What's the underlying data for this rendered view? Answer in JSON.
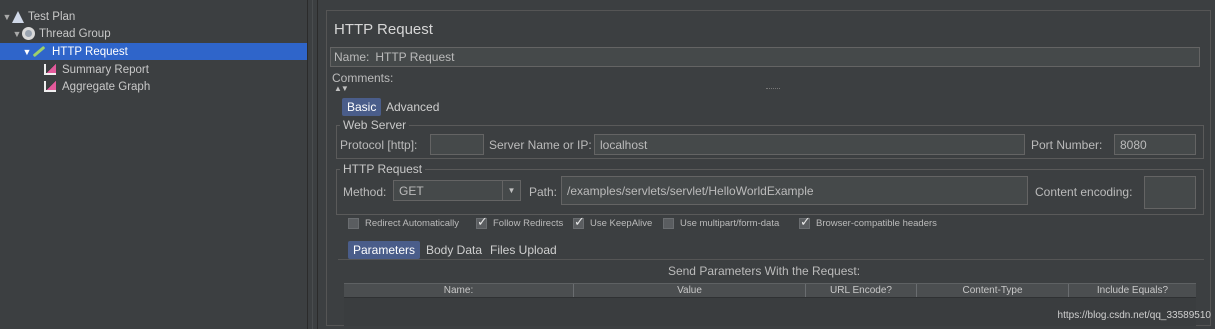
{
  "tree": {
    "items": [
      {
        "label": "Test Plan",
        "icon": "test-plan-icon"
      },
      {
        "label": "Thread Group",
        "icon": "thread-group-icon"
      },
      {
        "label": "HTTP Request",
        "icon": "http-request-icon",
        "selected": true
      },
      {
        "label": "Summary Report",
        "icon": "summary-report-icon"
      },
      {
        "label": "Aggregate Graph",
        "icon": "aggregate-graph-icon"
      }
    ]
  },
  "panel": {
    "title": "HTTP Request",
    "name_label": "Name:",
    "name_value": "HTTP Request",
    "comments_label": "Comments:",
    "collapse_glyph": "▲▼",
    "tabs": [
      {
        "label": "Basic",
        "active": true
      },
      {
        "label": "Advanced",
        "active": false
      }
    ],
    "web_server": {
      "title": "Web Server",
      "protocol_label": "Protocol [http]:",
      "protocol_value": "",
      "server_label": "Server Name or IP:",
      "server_value": "localhost",
      "port_label": "Port Number:",
      "port_value": "8080"
    },
    "http_request": {
      "title": "HTTP Request",
      "method_label": "Method:",
      "method_value": "GET",
      "path_label": "Path:",
      "path_value": "/examples/servlets/servlet/HelloWorldExample",
      "encoding_label": "Content encoding:",
      "encoding_value": ""
    },
    "checkboxes": [
      {
        "label": "Redirect Automatically",
        "checked": false
      },
      {
        "label": "Follow Redirects",
        "checked": true
      },
      {
        "label": "Use KeepAlive",
        "checked": true
      },
      {
        "label": "Use multipart/form-data",
        "checked": false
      },
      {
        "label": "Browser-compatible headers",
        "checked": true
      }
    ],
    "param_tabs": [
      {
        "label": "Parameters",
        "active": true
      },
      {
        "label": "Body Data",
        "active": false
      },
      {
        "label": "Files Upload",
        "active": false
      }
    ],
    "params_title": "Send Parameters With the Request:",
    "columns": [
      "Name:",
      "Value",
      "URL Encode?",
      "Content-Type",
      "Include Equals?"
    ]
  },
  "watermark": "https://blog.csdn.net/qq_33589510",
  "colors": {
    "selection": "#2f65ca",
    "background": "#3c3f41",
    "active_tab": "#4a5d8a"
  }
}
